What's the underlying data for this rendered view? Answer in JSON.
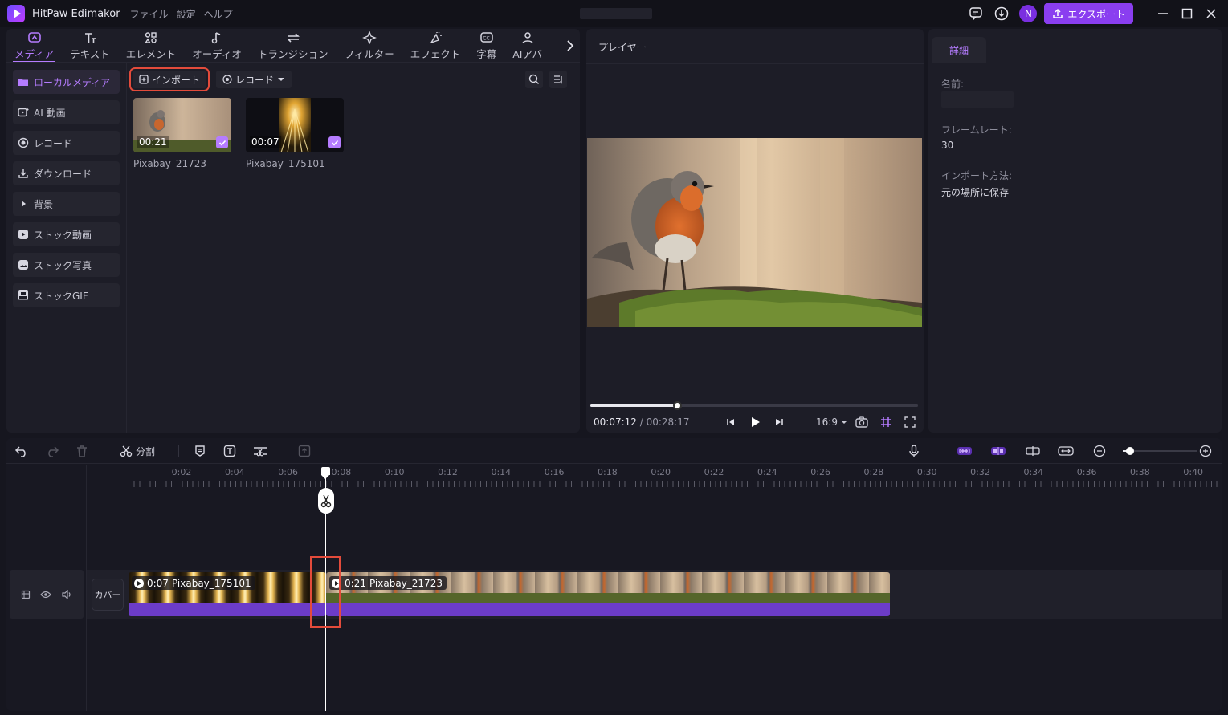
{
  "app": {
    "title": "HitPaw Edimakor",
    "menu": [
      "ファイル",
      "設定",
      "ヘルプ"
    ],
    "avatar_initial": "N",
    "export_label": "エクスポート",
    "accent": "#8a3ef0"
  },
  "media_tabs": [
    {
      "label": "メディア",
      "icon": "media-icon",
      "active": true
    },
    {
      "label": "テキスト",
      "icon": "text-icon"
    },
    {
      "label": "エレメント",
      "icon": "element-icon"
    },
    {
      "label": "オーディオ",
      "icon": "audio-icon"
    },
    {
      "label": "トランジション",
      "icon": "transition-icon"
    },
    {
      "label": "フィルター",
      "icon": "filter-icon"
    },
    {
      "label": "エフェクト",
      "icon": "effect-icon"
    },
    {
      "label": "字幕",
      "icon": "subtitle-icon"
    },
    {
      "label": "AIアバ",
      "icon": "avatar-icon"
    }
  ],
  "sidebar": {
    "items": [
      {
        "label": "ローカルメディア",
        "icon": "folder-icon",
        "active": true
      },
      {
        "label": "AI 動画",
        "icon": "ai-video-icon"
      },
      {
        "label": "レコード",
        "icon": "record-icon"
      },
      {
        "label": "ダウンロード",
        "icon": "download-icon"
      },
      {
        "label": "背景",
        "icon": "triangle-right-icon"
      },
      {
        "label": "ストック動画",
        "icon": "stock-video-icon"
      },
      {
        "label": "ストック写真",
        "icon": "stock-photo-icon"
      },
      {
        "label": "ストックGIF",
        "icon": "gif-icon"
      }
    ]
  },
  "media_toolbar": {
    "import_label": "インポート",
    "record_label": "レコード"
  },
  "media_items": [
    {
      "name": "Pixabay_21723",
      "duration": "00:21",
      "checked": true
    },
    {
      "name": "Pixabay_175101",
      "duration": "00:07",
      "checked": true
    }
  ],
  "player": {
    "title": "プレイヤー",
    "current_time": "00:07:12",
    "separator": " / ",
    "total_time": "00:28:17",
    "progress": 0.265,
    "ratio": "16:9"
  },
  "details": {
    "tab_label": "詳細",
    "name_label": "名前:",
    "framerate_label": "フレームレート:",
    "framerate_value": "30",
    "import_method_label": "インポート方法:",
    "import_method_value": "元の場所に保存"
  },
  "timeline": {
    "split_label": "分割",
    "cover_label": "カバー",
    "ruler_labels": [
      "0:02",
      "0:04",
      "0:06",
      "0:08",
      "0:10",
      "0:12",
      "0:14",
      "0:16",
      "0:18",
      "0:20",
      "0:22",
      "0:24",
      "0:26",
      "0:28",
      "0:30",
      "0:32",
      "0:34",
      "0:36",
      "0:38",
      "0:40"
    ],
    "zoom_level": 0.1,
    "clips": [
      {
        "duration": "0:07",
        "name": "Pixabay_175101"
      },
      {
        "duration": "0:21",
        "name": "Pixabay_21723"
      }
    ]
  }
}
